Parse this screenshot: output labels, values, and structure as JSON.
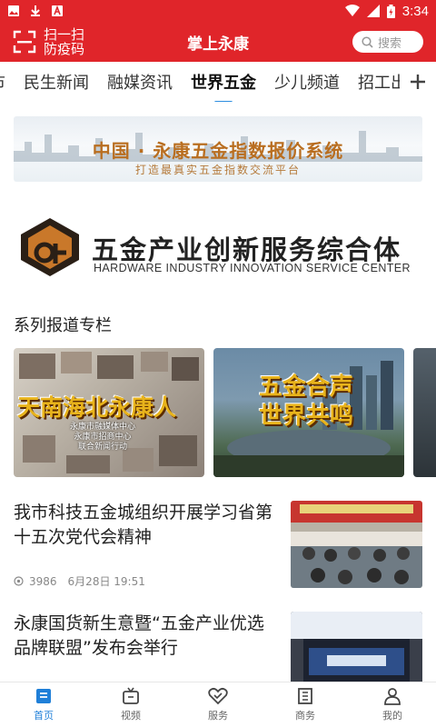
{
  "status_bar": {
    "time": "3:34"
  },
  "header": {
    "scan_label_line1": "扫一扫",
    "scan_label_line2": "防疫码",
    "title": "掌上永康",
    "search_placeholder": "搜索"
  },
  "tabs": [
    {
      "label": "市"
    },
    {
      "label": "民生新闻"
    },
    {
      "label": "融媒资讯"
    },
    {
      "label": "世界五金",
      "active": true
    },
    {
      "label": "少儿频道"
    },
    {
      "label": "招工出租"
    }
  ],
  "banner1": {
    "title": "中国 · 永康五金指数报价系统",
    "subtitle": "打造最真实五金指数交流平台"
  },
  "banner2": {
    "title": "五金产业创新服务综合体",
    "subtitle": "HARDWARE INDUSTRY INNOVATION SERVICE CENTER"
  },
  "section": {
    "title": "系列报道专栏"
  },
  "carousel": [
    {
      "text": "天南海北永康人",
      "sub1": "永康市融媒体中心",
      "sub2": "永康市招商中心",
      "sub3": "联合新闻行动"
    },
    {
      "text_line1": "五金合声",
      "text_line2": "世界共鸣"
    }
  ],
  "news": [
    {
      "title": "我市科技五金城组织开展学习省第十五次党代会精神",
      "views": "3986",
      "date": "6月28日 19:51"
    },
    {
      "title": "永康国货新生意暨“五金产业优选品牌联盟”发布会举行"
    }
  ],
  "bottom_nav": [
    {
      "label": "首页",
      "icon": "home-icon",
      "active": true
    },
    {
      "label": "视频",
      "icon": "tv-icon"
    },
    {
      "label": "服务",
      "icon": "heart-icon"
    },
    {
      "label": "商务",
      "icon": "building-icon"
    },
    {
      "label": "我的",
      "icon": "user-icon"
    }
  ],
  "colors": {
    "brand_red": "#e0252a",
    "active_blue": "#1f7fd8"
  }
}
